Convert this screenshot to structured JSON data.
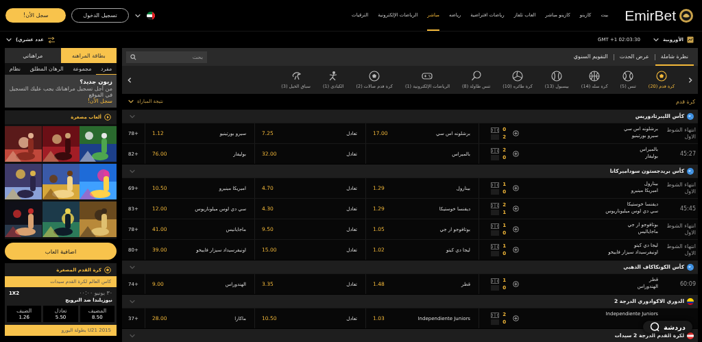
{
  "header": {
    "logo": "EmirBet",
    "nav": [
      {
        "label": "بيت",
        "selected": false
      },
      {
        "label": "كازينو",
        "selected": false
      },
      {
        "label": "كازينو مباشر",
        "selected": false
      },
      {
        "label": "العاب تلفاز",
        "selected": false
      },
      {
        "label": "رياضات افتراضية",
        "selected": false
      },
      {
        "label": "رياضه",
        "selected": false
      },
      {
        "label": "مباشر",
        "selected": true
      },
      {
        "label": "الرياضات الإلكترونية",
        "selected": false
      },
      {
        "label": "الترقيات",
        "selected": false
      }
    ],
    "login_button": "تسجيل الدخول",
    "signup_button": "سجل الأن!"
  },
  "subbar": {
    "odds_format": "الأوروبية",
    "clock": "GMT +1 02:03:30",
    "odds_type": "عدد عشري)"
  },
  "view_tabs": [
    {
      "label": "نظرة شاملة",
      "selected": true
    },
    {
      "label": "عرض الحدث",
      "selected": false
    },
    {
      "label": "التقويم السنوي",
      "selected": false
    }
  ],
  "search": {
    "placeholder": "بحث"
  },
  "sports": [
    {
      "label": "كرة قدم (20)",
      "kind": "soccer",
      "selected": true
    },
    {
      "label": "تنس (5)",
      "kind": "tennis",
      "selected": false
    },
    {
      "label": "كرة سله (14)",
      "kind": "basketball",
      "selected": false
    },
    {
      "label": "بيسبول (13)",
      "kind": "baseball",
      "selected": false
    },
    {
      "label": "كرة طائره (10)",
      "kind": "volleyball",
      "selected": false
    },
    {
      "label": "تنس طاولة (8)",
      "kind": "paddle",
      "selected": false
    },
    {
      "label": "الرياضات الإلكترونية (1)",
      "kind": "gamepad",
      "selected": false
    },
    {
      "label": "كرة قدم صالات (2)",
      "kind": "soccer",
      "selected": false
    },
    {
      "label": "الكبادي (1)",
      "kind": "figure",
      "selected": false
    },
    {
      "label": "سباق الخيل (3)",
      "kind": "horse",
      "selected": false
    }
  ],
  "section_title": "كرة قدم",
  "market_select": "نتيجة المباراة",
  "leagues": [
    {
      "name": "كأس الليبرتادوريس",
      "kind": "world",
      "matches": [
        {
          "status": "انتهاء الشوط الاول",
          "team1": "برشلونه اس سي",
          "team2": "سيرو بورتينيو",
          "score1": "0",
          "score2": "2",
          "odds": [
            {
              "label": "برشلونه اس سي",
              "price": "17.00"
            },
            {
              "label": "تعادل",
              "price": "7.25"
            },
            {
              "label": "سيرو بورتينيو",
              "price": "1.12"
            }
          ],
          "more": "78+"
        },
        {
          "status": "45:27",
          "team1": "بالميراس",
          "team2": "بوليفار",
          "score1": "2",
          "score2": "0",
          "odds": [
            {
              "label": "بالميراس"
            },
            {
              "label": "تعادل",
              "price": "32.00"
            },
            {
              "label": "بوليفار",
              "price": "76.00"
            }
          ],
          "more": "82+"
        }
      ]
    },
    {
      "name": "كأس بريدجستون سوداميركانا",
      "kind": "world",
      "matches": [
        {
          "status": "انتهاء الشوط الاول",
          "team1": "بينارول",
          "team2": "اميريكا مينيرو",
          "score1": "1",
          "score2": "0",
          "odds": [
            {
              "label": "بينارول",
              "price": "1.29"
            },
            {
              "label": "تعادل",
              "price": "4.70"
            },
            {
              "label": "اميريكا مينيرو",
              "price": "10.50"
            }
          ],
          "more": "69+"
        },
        {
          "status": "45:45",
          "team1": "ديفنسا خوستيكا",
          "team2": "سي دي لوس ميليوناريوس",
          "score1": "2",
          "score2": "1",
          "odds": [
            {
              "label": "ديفنسا خوستيكا",
              "price": "1.29"
            },
            {
              "label": "تعادل",
              "price": "4.30"
            },
            {
              "label": "سي دي لوس ميلوناريوس",
              "price": "12.00"
            }
          ],
          "more": "83+"
        },
        {
          "status": "انتهاء الشوط الاول",
          "team1": "بوتافوجو ار جي",
          "team2": "ماجاياليس",
          "score1": "1",
          "score2": "0",
          "odds": [
            {
              "label": "بوتافوجو ار جي",
              "price": "1.05"
            },
            {
              "label": "تعادل",
              "price": "9.50"
            },
            {
              "label": "ماجايانيس",
              "price": "41.00"
            }
          ],
          "more": "78+"
        },
        {
          "status": "انتهاء الشوط الاول",
          "team1": "ليجا دي كيتو",
          "team2": "اونيفرسيداد سيزار فاييخو",
          "score1": "1",
          "score2": "0",
          "odds": [
            {
              "label": "ليجا دي كيتو",
              "price": "1.02"
            },
            {
              "label": "تعادل",
              "price": "15.00"
            },
            {
              "label": "اونيفرسيداد سيزار فاييخو",
              "price": "39.00"
            }
          ],
          "more": "80+"
        }
      ]
    },
    {
      "name": "كأس الكونكاكاف الذهبي",
      "kind": "world",
      "matches": [
        {
          "status": "60:09",
          "team1": "قطر",
          "team2": "الهندوراس",
          "score1": "1",
          "score2": "0",
          "odds": [
            {
              "label": "قطر",
              "price": "1.48"
            },
            {
              "label": "تعادل",
              "price": "3.35"
            },
            {
              "label": "الهندوراس",
              "price": "9.00"
            }
          ],
          "more": "74+"
        }
      ]
    },
    {
      "name": "الدوري الاكوادوري الدرجة 2",
      "kind": "ecuador",
      "matches": [
        {
          "team1": "Independiente Juniors",
          "score1": "2",
          "score2": "0",
          "odds": [
            {
              "label": "Independiente Juniors",
              "price": "1.03"
            },
            {
              "label": "تعادل",
              "price": "10.50"
            },
            {
              "label": "ماكارا",
              "price": "28.00"
            }
          ],
          "more": "37+"
        }
      ]
    },
    {
      "name": "لكرة القدم الدرجة 2 سيدات",
      "kind": "redflag"
    }
  ],
  "betslip": {
    "tabs": [
      {
        "label": "بطاقة المراهنه",
        "selected": true
      },
      {
        "label": "مراهناتي",
        "selected": false
      }
    ],
    "bet_types": [
      {
        "label": "مفرد",
        "selected": true
      },
      {
        "label": "مجموعة",
        "selected": false
      },
      {
        "label": "الرهان المطلق",
        "selected": false
      },
      {
        "label": "نظام",
        "selected": false
      }
    ],
    "promo": {
      "title": "زبون جديد؟",
      "text": "من أجل تسجيل مراهناتك يجب عليك التسجيل في الموقع",
      "link": "سجل الأن!"
    }
  },
  "mini_games": {
    "title": "ألعاب مصغرة",
    "more_button": "اضافية العاب"
  },
  "mini_football": {
    "title": "كرة القدم المصغرة",
    "competitions": [
      {
        "name": "كاس العالم لكرة القدم سيدات",
        "date": "٣٠ يونيو ٠٠:٠٠",
        "market": "1X2",
        "match": "نيوزيلندا ضد النرويج",
        "odds": [
          {
            "label": "المضيف",
            "price": "8.50"
          },
          {
            "label": "تعادل",
            "price": "5.50"
          },
          {
            "label": "الضيف",
            "price": "1.26"
          }
        ]
      },
      {
        "name": "U21 2015 بطولة اليورو"
      }
    ]
  },
  "chat_button": "دردشة"
}
